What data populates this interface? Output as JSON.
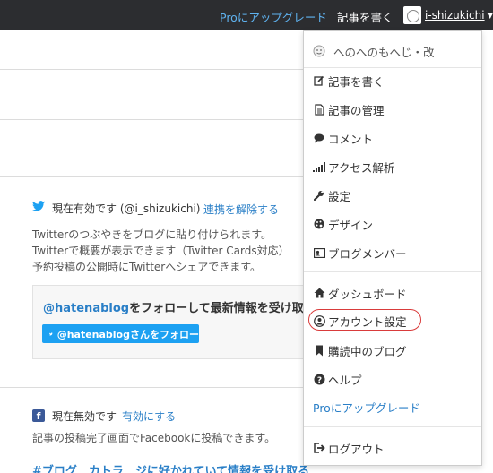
{
  "topbar": {
    "pro_link": "Proにアップグレード",
    "write_link": "記事を書く",
    "username": "i-shizukichi",
    "user_avatar_icon": "blog-avatar-icon",
    "caret_icon": "caret-down-icon"
  },
  "twitter": {
    "status_label": "現在有効です",
    "account": "(@i_shizukichi)",
    "unlink_link": "連携を解除する",
    "desc_lines": [
      "Twitterのつぶやきをブログに貼り付けられます。",
      "Twitterで概要が表示できます（Twitter Cards対応）",
      "予約投稿の公開時にTwitterへシェアできます。"
    ],
    "follow_title_handle": "@hatenablog",
    "follow_title_rest": "をフォローして最新情報を受け取る",
    "follow_button": "@hatenablogさんをフォロー"
  },
  "facebook": {
    "status_label": "現在無効です",
    "enable_link": "有効にする",
    "desc": "記事の投稿完了画面でFacebookに投稿できます。",
    "bottom_cut_text": "#ブログ　カトラ　ジに好かれていて情報を受け取る"
  },
  "dropdown": {
    "blog_name": "へのへのもへじ・改",
    "items": [
      {
        "label": "記事を書く",
        "icon": "edit-icon"
      },
      {
        "label": "記事の管理",
        "icon": "document-icon"
      },
      {
        "label": "コメント",
        "icon": "comment-icon"
      },
      {
        "label": "アクセス解析",
        "icon": "signal-bars-icon"
      },
      {
        "label": "設定",
        "icon": "wrench-icon"
      },
      {
        "label": "デザイン",
        "icon": "palette-icon"
      },
      {
        "label": "ブログメンバー",
        "icon": "member-card-icon"
      }
    ],
    "items2": [
      {
        "label": "ダッシュボード",
        "icon": "home-icon"
      },
      {
        "label": "アカウント設定",
        "icon": "user-circle-icon"
      },
      {
        "label": "購読中のブログ",
        "icon": "bookmark-icon"
      },
      {
        "label": "ヘルプ",
        "icon": "question-icon"
      }
    ],
    "pro_upgrade": "Proにアップグレード",
    "logout": "ログアウト",
    "logout_icon": "logout-icon"
  },
  "colors": {
    "topbar_bg": "#2c2d30",
    "link_blue": "#2a7fc7",
    "twitter_blue": "#1da1f2",
    "highlight_red": "#d93b3b"
  }
}
